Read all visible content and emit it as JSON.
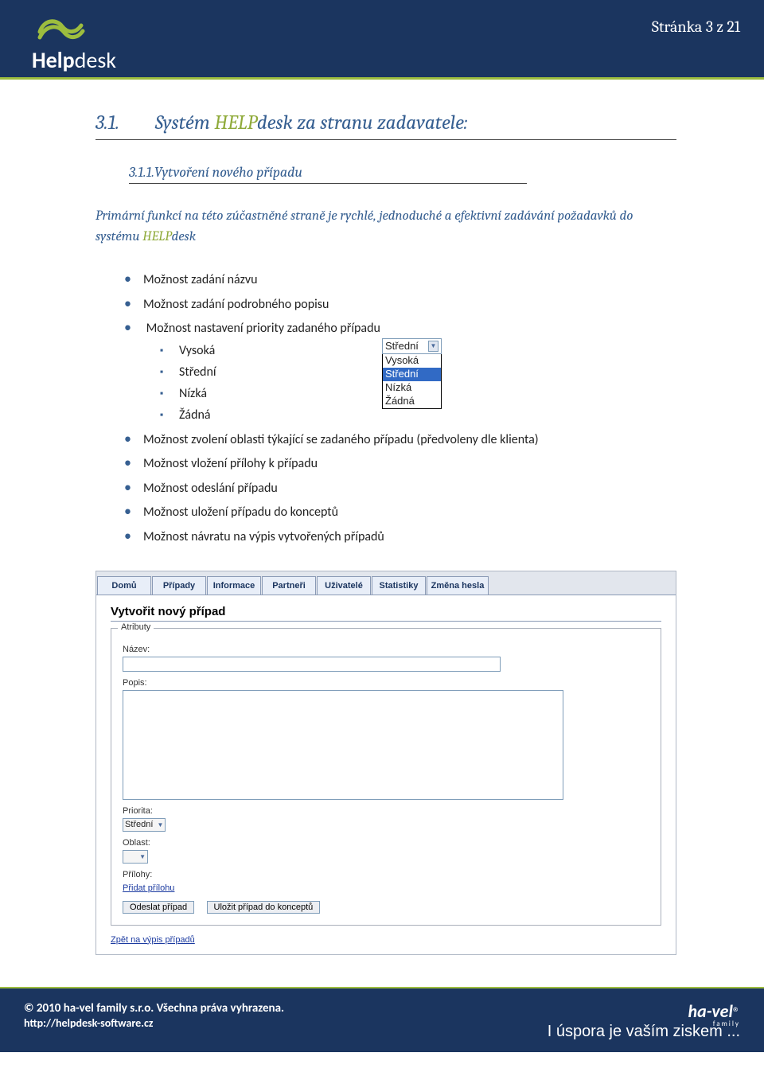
{
  "page_number": "Stránka 3 z 21",
  "logo": {
    "help": "Help",
    "desk": "desk"
  },
  "h1": {
    "num": "3.1.",
    "pre": "Systém ",
    "help": "HELP",
    "desk": "desk",
    "post": " za stranu zadavatele:"
  },
  "h2": "3.1.1.Vytvoření nového případu",
  "intro": {
    "line1": "Primární funkcí na této zúčastněné straně je rychlé, jednoduché a efektivní zadávání požadavků do systému ",
    "help": "HELP",
    "desk": "desk"
  },
  "bullets": [
    "Možnost zadání názvu",
    "Možnost zadání podrobného popisu",
    "Možnost nastavení priority zadaného případu"
  ],
  "sub_priority": [
    "Vysoká",
    "Střední",
    "Nízká",
    "Žádná"
  ],
  "dropdown_demo": {
    "selected": "Střední",
    "options": [
      "Vysoká",
      "Střední",
      "Nízká",
      "Žádná"
    ],
    "highlighted": "Střední"
  },
  "bullets2": [
    "Možnost zvolení oblasti týkající se zadaného případu (předvoleny dle klienta)",
    "Možnost vložení přílohy k případu",
    "Možnost odeslání případu",
    "Možnost uložení případu do konceptů",
    "Možnost návratu na výpis vytvořených případů"
  ],
  "ui": {
    "tabs": [
      "Domů",
      "Případy",
      "Informace",
      "Partneři",
      "Uživatelé",
      "Statistiky",
      "Změna hesla"
    ],
    "panel_title": "Vytvořit nový případ",
    "legend": "Atributy",
    "labels": {
      "nazev": "Název:",
      "popis": "Popis:",
      "priorita": "Priorita:",
      "oblast": "Oblast:",
      "prilohy": "Přílohy:"
    },
    "priorita_value": "Střední",
    "add_attachment": "Přidat přílohu",
    "buttons": {
      "send": "Odeslat případ",
      "save": "Uložit případ do konceptů"
    },
    "back": "Zpět na výpis případů"
  },
  "footer": {
    "copyright": "© 2010 ha-vel family s.r.o. Všechna práva vyhrazena.",
    "url": "http://helpdesk-software.cz",
    "brand": "ha-vel",
    "brand_sub": "family",
    "slogan": "I úspora je vaším ziskem ..."
  }
}
